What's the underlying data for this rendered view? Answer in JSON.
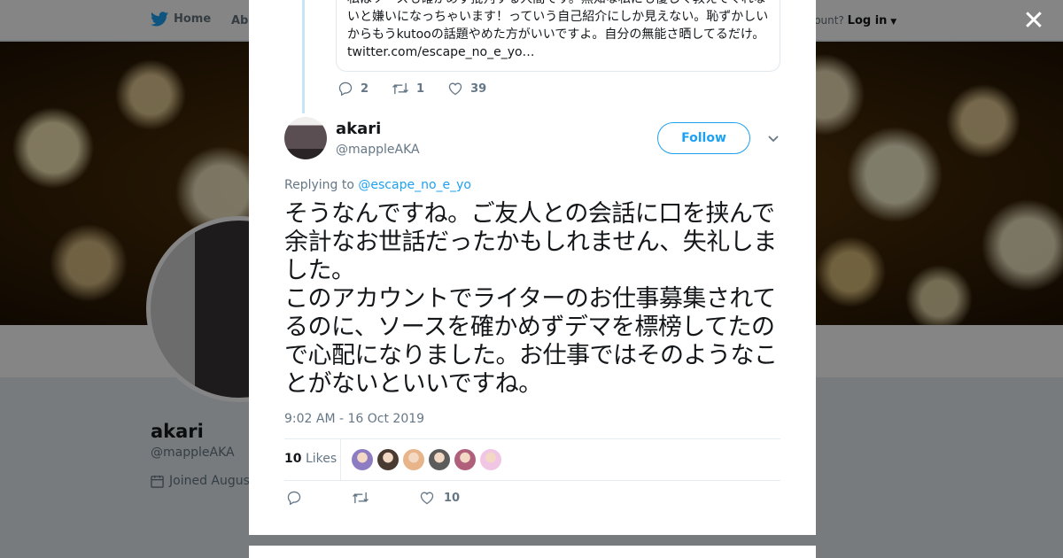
{
  "topbar": {
    "home_label": "Home",
    "about_label": "Abo",
    "account_prompt": "ccount?",
    "login_label": "Log in"
  },
  "profile": {
    "name": "akari",
    "handle": "@mappleAKA",
    "joined": "Joined August"
  },
  "parent_tweet": {
    "quote_text": "私はソースも確かめず批判する人間です。無知な私にも優しく教えてくれないと嫌いになっちゃいます！っていう自己紹介にしか見えない。恥ずかしいからもうkutooの話題やめた方がいいですよ。自分の無能さ晒してるだけ。\ntwitter.com/escape_no_e_yo…",
    "reply_count": "2",
    "retweet_count": "1",
    "like_count": "39"
  },
  "tweet": {
    "author_name": "akari",
    "author_handle": "@mappleAKA",
    "follow_label": "Follow",
    "replying_prefix": "Replying to",
    "replying_handle": "@escape_no_e_yo",
    "text": "そうなんですね。ご友人との会話に口を挟んで余計なお世話だったかもしれません、失礼しました。\nこのアカウントでライターのお仕事募集されてるのに、ソースを確かめずデマを標榜してたので心配になりました。お仕事ではそのようなことがないといいですね。",
    "timestamp": "9:02 AM - 16 Oct 2019",
    "likes_number": "10",
    "likes_label": "Likes",
    "like_count": "10"
  },
  "likers": [
    "#8e7cc3",
    "#4a3b32",
    "#e8b48a",
    "#5c5c5c",
    "#b0607a",
    "#f0c6e4"
  ],
  "colors": {
    "accent": "#1da1f2",
    "muted": "#657786"
  }
}
